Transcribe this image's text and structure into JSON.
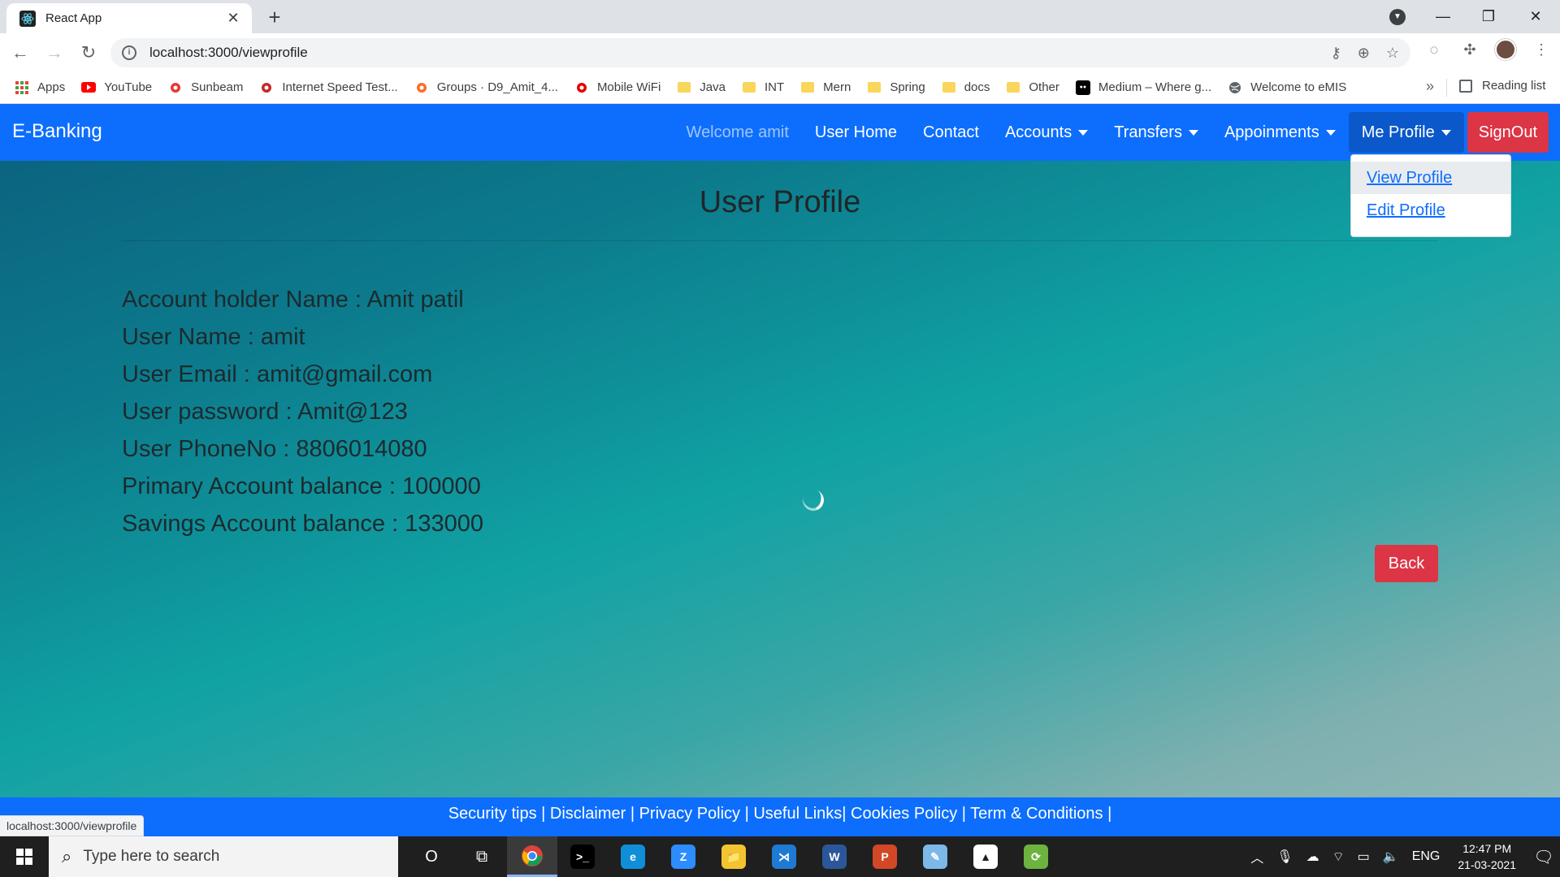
{
  "browser": {
    "tab_title": "React App",
    "tab_close": "✕",
    "new_tab": "+",
    "url": "localhost:3000/viewprofile",
    "bookmarks": [
      {
        "label": "Apps",
        "icon": "apps-grid-icon",
        "color": "#ea4335"
      },
      {
        "label": "YouTube",
        "icon": "youtube-icon",
        "color": "#ff0000"
      },
      {
        "label": "Sunbeam",
        "icon": "sunbeam-icon",
        "color": "#e53935"
      },
      {
        "label": "Internet Speed Test...",
        "icon": "speedometer-icon",
        "color": "#c62828"
      },
      {
        "label": "Groups · D9_Amit_4...",
        "icon": "gitlab-icon",
        "color": "#fc6d26"
      },
      {
        "label": "Mobile WiFi",
        "icon": "airtel-icon",
        "color": "#e40000"
      },
      {
        "label": "Java",
        "icon": "folder-icon",
        "color": "#f9d65c"
      },
      {
        "label": "INT",
        "icon": "folder-icon",
        "color": "#f9d65c"
      },
      {
        "label": "Mern",
        "icon": "folder-icon",
        "color": "#f9d65c"
      },
      {
        "label": "Spring",
        "icon": "folder-icon",
        "color": "#f9d65c"
      },
      {
        "label": "docs",
        "icon": "folder-icon",
        "color": "#f9d65c"
      },
      {
        "label": "Other",
        "icon": "folder-icon",
        "color": "#f9d65c"
      },
      {
        "label": "Medium – Where g...",
        "icon": "medium-icon",
        "color": "#000000"
      },
      {
        "label": "Welcome to eMIS",
        "icon": "globe-icon",
        "color": "#5f6368"
      }
    ],
    "bookmarks_more": "»",
    "reading_list": "Reading list",
    "status_url": "localhost:3000/viewprofile"
  },
  "app": {
    "brand": "E-Banking",
    "nav": {
      "welcome": "Welcome amit",
      "user_home": "User Home",
      "contact": "Contact",
      "accounts": "Accounts",
      "transfers": "Transfers",
      "appointments": "Appoinments",
      "me_profile": "Me Profile",
      "signout": "SignOut"
    },
    "dropdown": {
      "view_profile": "View Profile",
      "edit_profile": "Edit Profile"
    },
    "page_title": "User Profile",
    "details": [
      "Account holder Name : Amit patil",
      "User Name : amit",
      "User Email : amit@gmail.com",
      "User password : Amit@123",
      "User PhoneNo : 8806014080",
      "Primary Account balance : 100000",
      "Savings Account balance : 133000"
    ],
    "back_button": "Back",
    "footer": "Security tips | Disclaimer | Privacy Policy | Useful Links| Cookies Policy | Term & Conditions |",
    "colors": {
      "primary": "#0d6efd",
      "danger": "#dc3545",
      "primary_active": "#0a58ca"
    }
  },
  "taskbar": {
    "search_placeholder": "Type here to search",
    "apps": [
      {
        "name": "cortana-icon",
        "label": "O",
        "color": "transparent"
      },
      {
        "name": "task-view-icon",
        "label": "⧉",
        "color": "transparent"
      },
      {
        "name": "chrome-icon",
        "label": "",
        "color": "#4285f4"
      },
      {
        "name": "terminal-icon",
        "label": ">_",
        "color": "#000000"
      },
      {
        "name": "edge-icon",
        "label": "e",
        "color": "#0f8fd8"
      },
      {
        "name": "zoom-icon",
        "label": "Z",
        "color": "#2d8cff"
      },
      {
        "name": "file-explorer-icon",
        "label": "📁",
        "color": "#f4c430"
      },
      {
        "name": "vscode-icon",
        "label": "⋊",
        "color": "#1f7ad4"
      },
      {
        "name": "word-icon",
        "label": "W",
        "color": "#2b579a"
      },
      {
        "name": "powerpoint-icon",
        "label": "P",
        "color": "#d24726"
      },
      {
        "name": "notes-icon",
        "label": "✎",
        "color": "#7cb9e8"
      },
      {
        "name": "photos-icon",
        "label": "▲",
        "color": "#ffffff"
      },
      {
        "name": "spring-tool-icon",
        "label": "⟳",
        "color": "#6db33f"
      }
    ],
    "language": "ENG",
    "time": "12:47 PM",
    "date": "21-03-2021"
  }
}
